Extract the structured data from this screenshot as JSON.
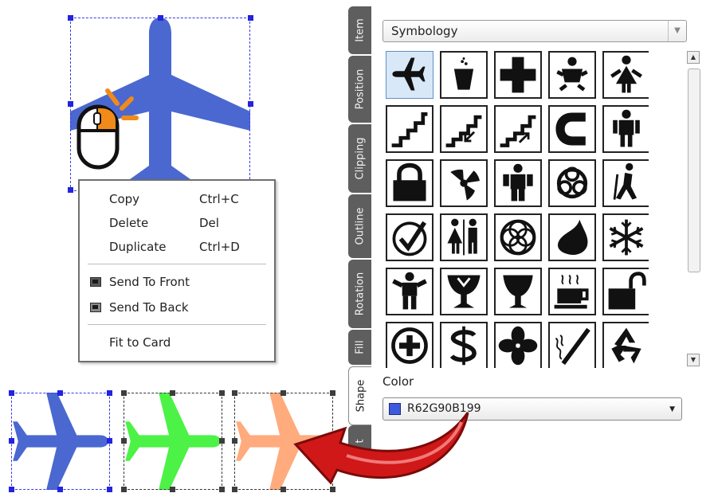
{
  "context_menu": {
    "items": [
      {
        "label": "Copy",
        "shortcut": "Ctrl+C"
      },
      {
        "label": "Delete",
        "shortcut": "Del"
      },
      {
        "label": "Duplicate",
        "shortcut": "Ctrl+D"
      },
      {
        "label": "Send To Front",
        "shortcut": ""
      },
      {
        "label": "Send To Back",
        "shortcut": ""
      },
      {
        "label": "Fit to Card",
        "shortcut": ""
      }
    ]
  },
  "tabs": [
    {
      "label": "Item",
      "active": false
    },
    {
      "label": "Position",
      "active": false
    },
    {
      "label": "Clipping",
      "active": false
    },
    {
      "label": "Outline",
      "active": false
    },
    {
      "label": "Rotation",
      "active": false
    },
    {
      "label": "Fill",
      "active": false
    },
    {
      "label": "Shape",
      "active": true
    },
    {
      "label": "t",
      "active": false
    }
  ],
  "panel": {
    "category": "Symbology",
    "symbols": [
      "airplane-icon",
      "trash-bin-icon",
      "medical-cross-icon",
      "baby-changing-icon",
      "woman-restroom-icon",
      "stairs-icon",
      "stairs-down-icon",
      "stairs-up-icon",
      "magnet-icon",
      "man-restroom-icon",
      "padlock-icon",
      "radiation-icon",
      "person-icon",
      "biohazard-icon",
      "hiker-icon",
      "checkmark-icon",
      "restrooms-icon",
      "ring-knot-icon",
      "drop-icon",
      "snowflake-icon",
      "person-arms-icon",
      "wine-glass-icon",
      "glass-icon",
      "coffee-cup-icon",
      "unlock-icon",
      "plus-circle-icon",
      "dollar-sign-icon",
      "fan-icon",
      "no-smoking-icon",
      "recycle-icon"
    ],
    "selected_symbol": "airplane-icon",
    "color_label": "Color",
    "color_value": "R62G90B199",
    "color_swatch": "#3e5adc"
  },
  "canvas": {
    "main_airplane_color": "#4a68d0",
    "copies": [
      {
        "color": "#4a68d0"
      },
      {
        "color": "#4cf246"
      },
      {
        "color": "#ffab7d"
      }
    ],
    "arrow_color": "#d01818"
  }
}
